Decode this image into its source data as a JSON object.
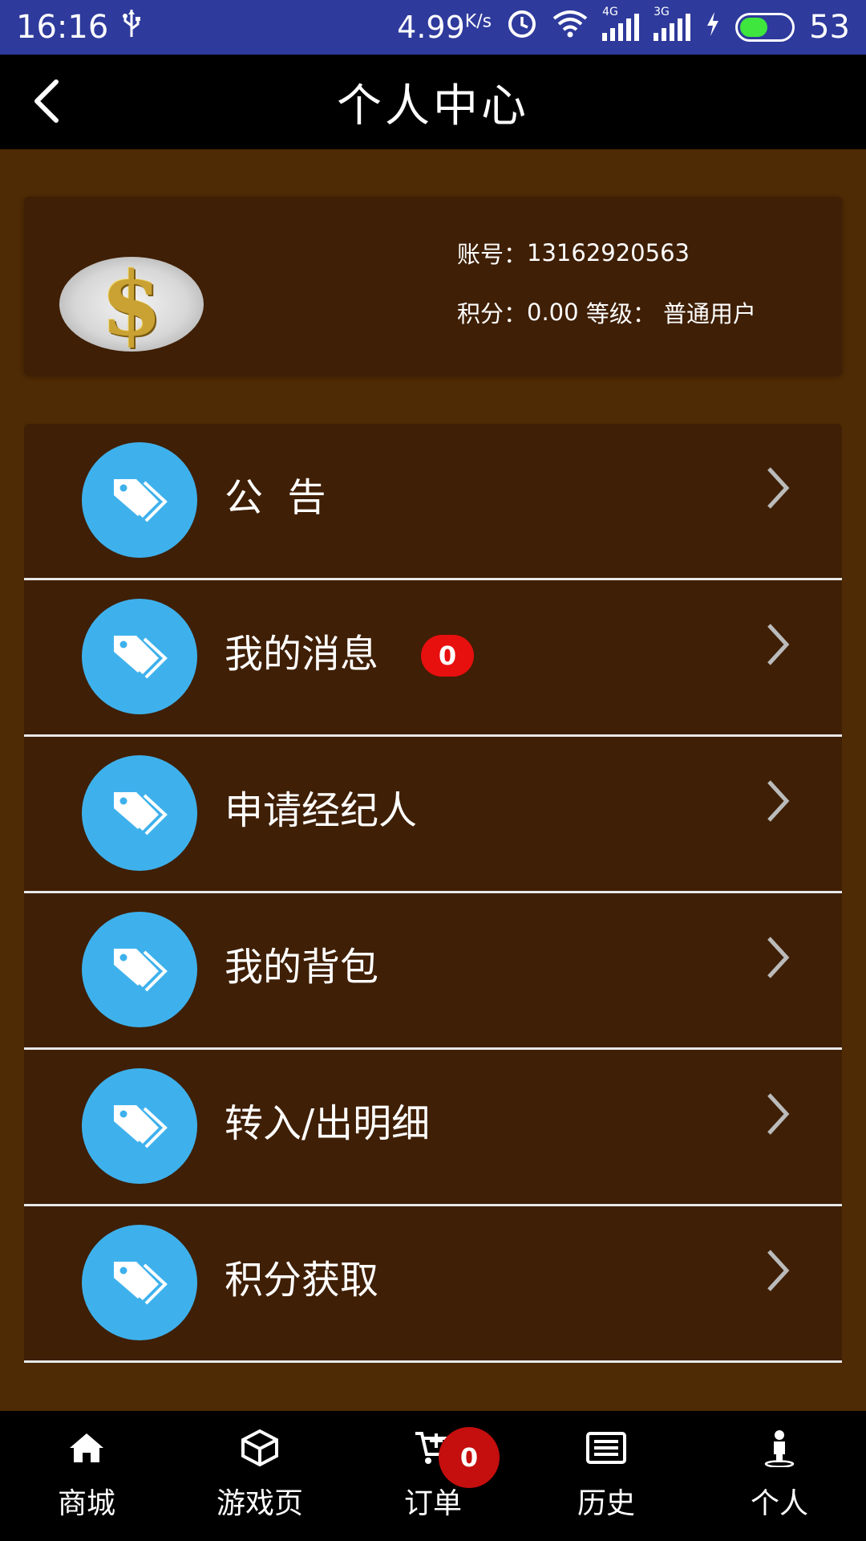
{
  "status_bar": {
    "time": "16:16",
    "speed": "4.99",
    "speed_unit": "K/s",
    "signal_1_tag": "4G",
    "signal_2_tag": "3G",
    "battery": "53"
  },
  "header": {
    "title": "个人中心"
  },
  "profile": {
    "account_label": "账号：",
    "account_value": "13162920563",
    "points_label": "积分：",
    "points_value": "0.00",
    "level_label": "等级：",
    "level_value": "普通用户"
  },
  "menu": {
    "items": [
      {
        "label": "公  告"
      },
      {
        "label": "我的消息",
        "badge": "0"
      },
      {
        "label": "申请经纪人"
      },
      {
        "label": "我的背包"
      },
      {
        "label": "转入/出明细"
      },
      {
        "label": "积分获取"
      }
    ]
  },
  "tabbar": {
    "tabs": [
      {
        "label": "商城",
        "icon": "home-icon"
      },
      {
        "label": "游戏页",
        "icon": "cube-icon"
      },
      {
        "label": "订单",
        "icon": "cart-icon",
        "badge": "0"
      },
      {
        "label": "历史",
        "icon": "list-icon"
      },
      {
        "label": "个人",
        "icon": "person-icon"
      }
    ]
  },
  "colors": {
    "status_bar": "#2e3a9c",
    "page_background": "#4e2a05",
    "card_background": "#3f1f05",
    "icon_circle": "#3eb1ec",
    "badge_red": "#e80f0f"
  }
}
